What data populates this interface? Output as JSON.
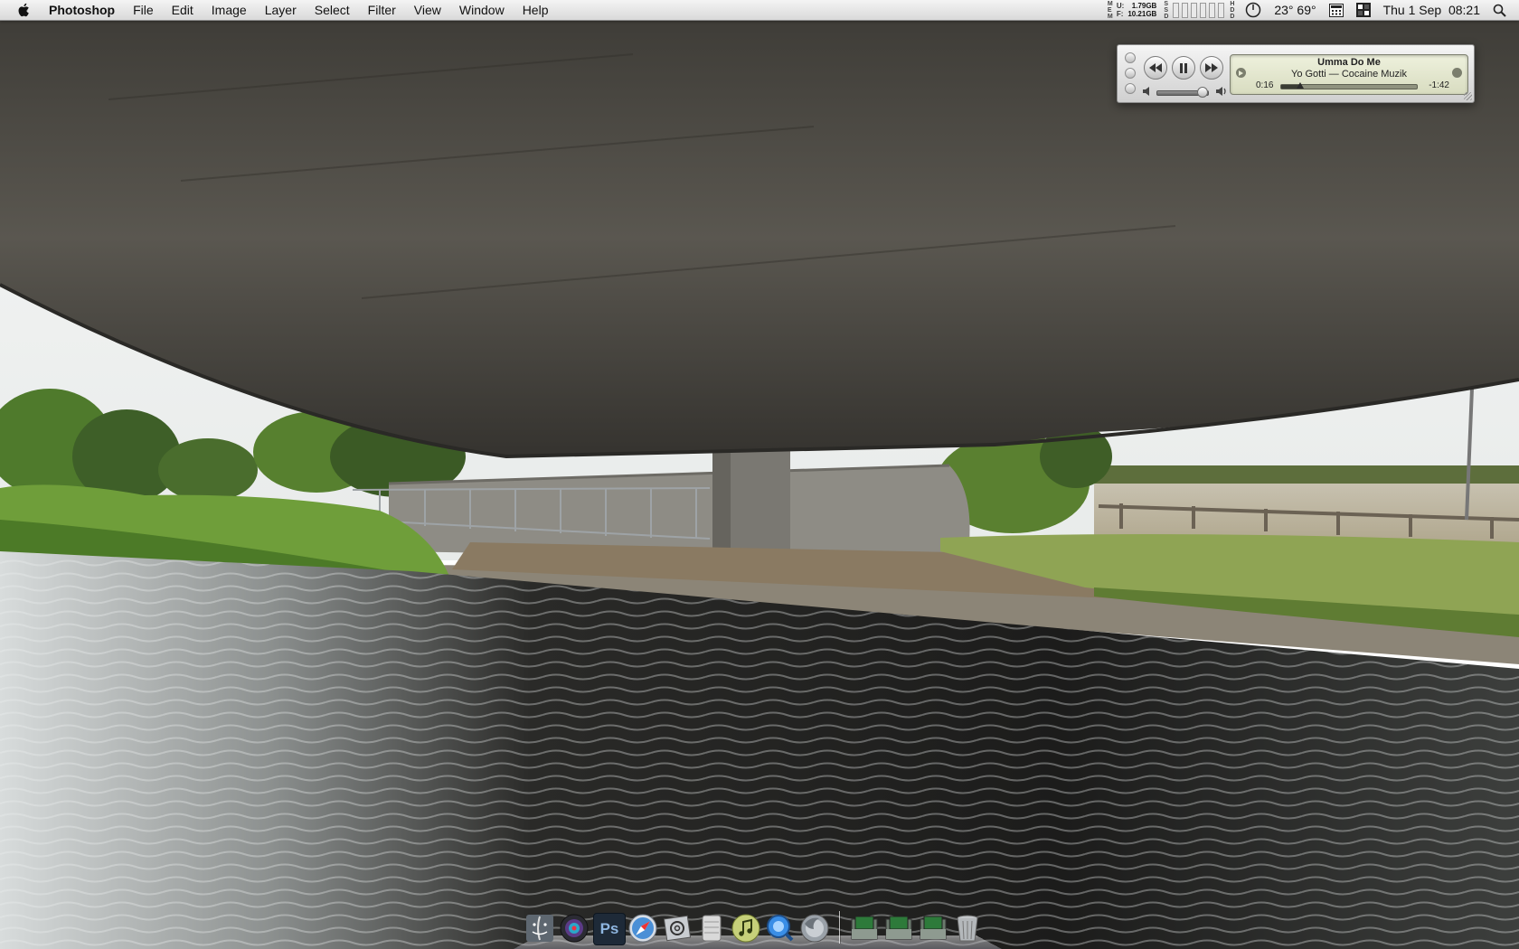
{
  "menubar": {
    "app_name": "Photoshop",
    "menus": [
      "File",
      "Edit",
      "Image",
      "Layer",
      "Select",
      "Filter",
      "View",
      "Window",
      "Help"
    ],
    "memory": {
      "labels": [
        "U:",
        "F:"
      ],
      "prefix_letters": [
        "M",
        "E",
        "M"
      ],
      "used": "1.79GB",
      "free": "10.21GB"
    },
    "disk_letters": [
      "S",
      "S",
      "D"
    ],
    "hdd_letters": [
      "H",
      "D",
      "D"
    ],
    "weather": "23° 69°",
    "datetime": "Thu 1 Sep  08:21",
    "icons": [
      "apple-logo-icon",
      "clock-icon",
      "calculator-icon",
      "spaces-icon",
      "spotlight-search-icon"
    ]
  },
  "mini_player": {
    "track_title": "Umma Do Me",
    "artist_album": "Yo Gotti — Cocaine Muzik",
    "elapsed": "0:16",
    "remaining": "-1:42",
    "progress_fraction": 0.14,
    "volume_fraction": 0.9
  },
  "dock": {
    "items": [
      "finder-icon",
      "aperture-icon",
      "photoshop-icon",
      "safari-icon",
      "mail-icon",
      "disk-utility-icon",
      "itunes-icon",
      "quicktime-icon",
      "firefox-icon",
      "stack-folder-1-icon",
      "stack-folder-2-icon",
      "stack-folder-3-icon",
      "trash-icon"
    ],
    "ps_label": "Ps"
  },
  "colors": {
    "menubar": "#e6e6e6",
    "lcd": "#e3e6cf",
    "concrete": "#4d4a43",
    "grass": "#6f9e3a",
    "water": "#1e1d1c"
  }
}
